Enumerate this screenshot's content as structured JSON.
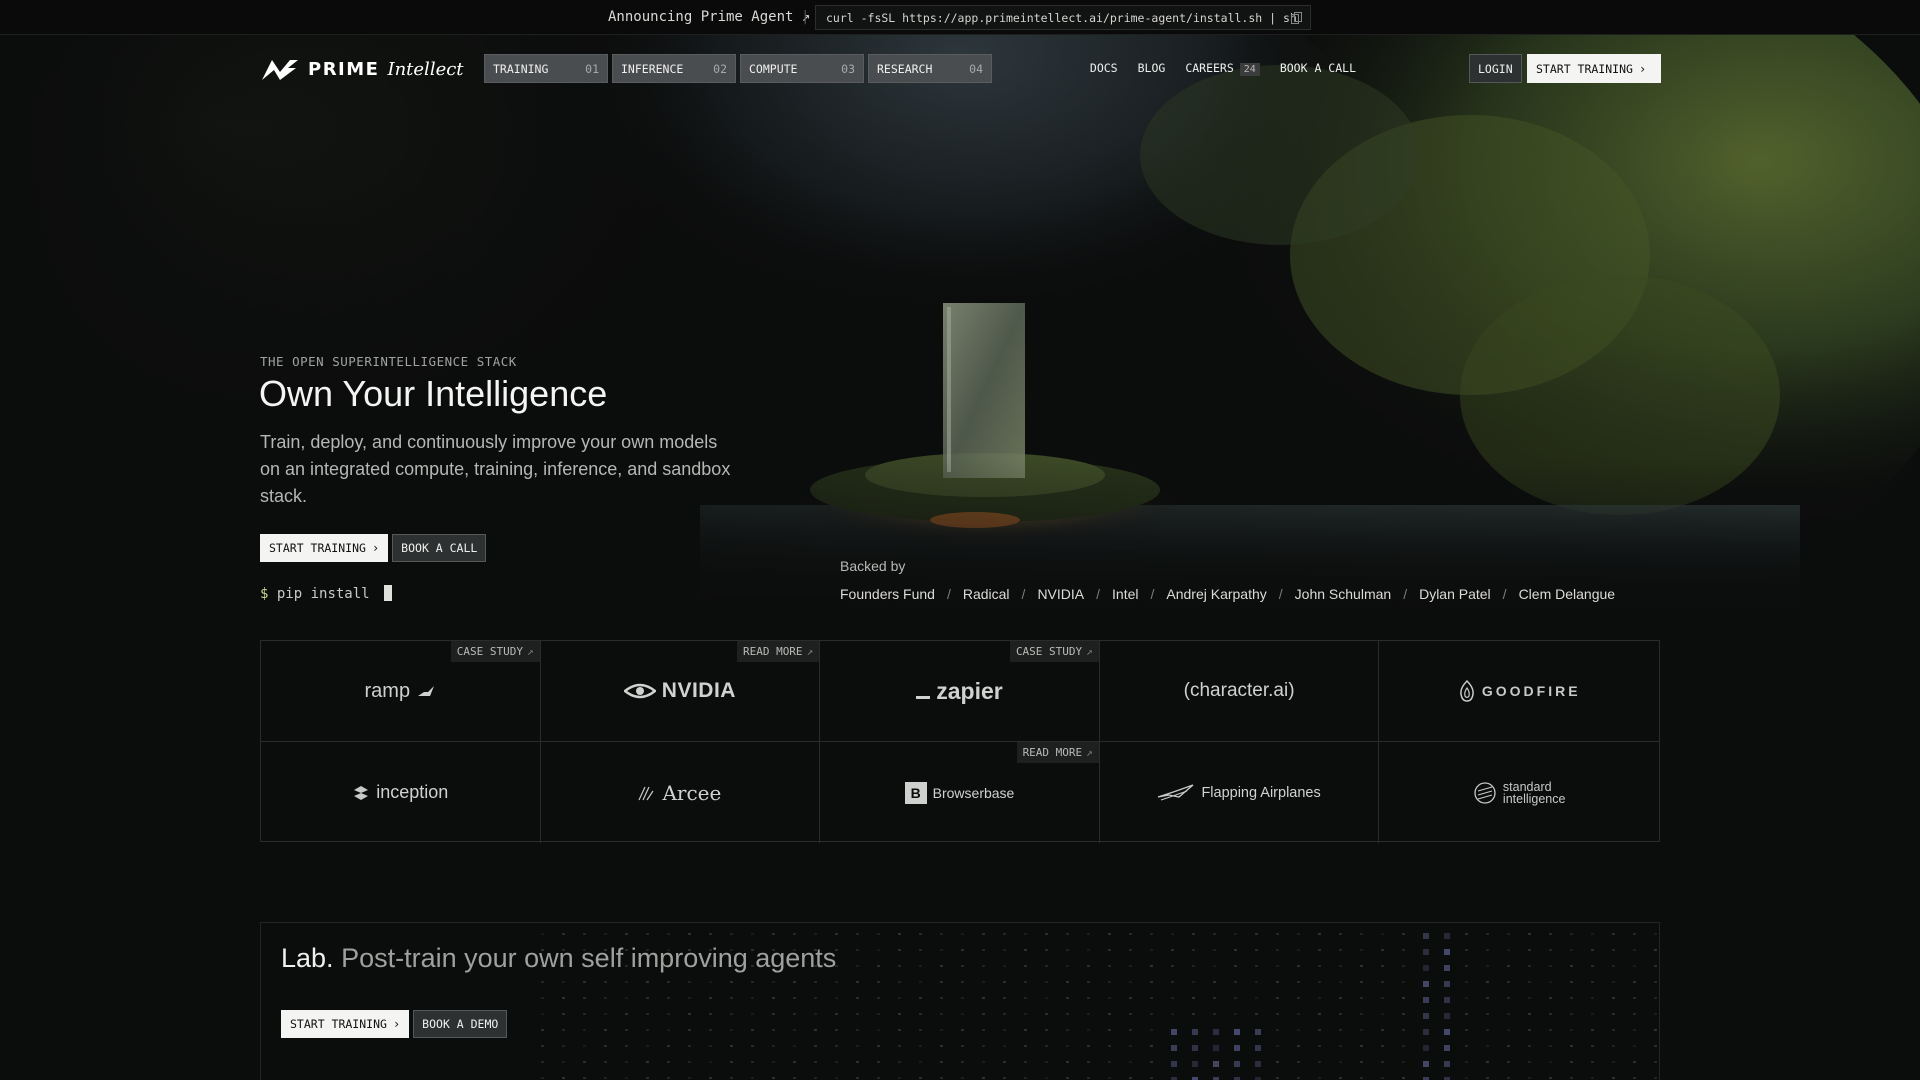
{
  "announcement": {
    "text": "Announcing Prime Agent ↗",
    "separator": "|",
    "command": "curl -fsSL https://app.primeintellect.ai/prime-agent/install.sh | sh",
    "copy_icon": "copy-icon"
  },
  "nav": {
    "logo_prime": "PRIME",
    "logo_intellect": "Intellect",
    "tabs": [
      {
        "label": "TRAINING",
        "num": "01"
      },
      {
        "label": "INFERENCE",
        "num": "02"
      },
      {
        "label": "COMPUTE",
        "num": "03"
      },
      {
        "label": "RESEARCH",
        "num": "04"
      }
    ],
    "links": {
      "docs": "DOCS",
      "blog": "BLOG",
      "careers": "CAREERS",
      "careers_count": "24",
      "book_call": "BOOK A CALL"
    },
    "login": "LOGIN",
    "start_training": "START TRAINING",
    "chevron": "›"
  },
  "hero": {
    "eyebrow": "THE OPEN SUPERINTELLIGENCE STACK",
    "title": "Own Your Intelligence",
    "subtitle": "Train, deploy, and continuously improve your own models on an integrated compute, training, inference, and sandbox stack.",
    "start_training": "START TRAINING",
    "book_call": "BOOK A CALL",
    "chevron": "›",
    "prompt_symbol": "$",
    "pip_command": "pip install",
    "backed_by_label": "Backed by",
    "backers": [
      "Founders Fund",
      "Radical",
      "NVIDIA",
      "Intel",
      "Andrej Karpathy",
      "John Schulman",
      "Dylan Patel",
      "Clem Delangue"
    ],
    "backer_separator": "/"
  },
  "logos": {
    "case_study": "CASE STUDY",
    "read_more": "READ MORE",
    "arrow": "↗",
    "ramp": "ramp",
    "nvidia": "NVIDIA",
    "zapier": "zapier",
    "characterai": "(character.ai)",
    "goodfire": "GOODFIRE",
    "inception": "inception",
    "arcee": "Arcee",
    "browserbase": "Browserbase",
    "browserbase_mark": "B",
    "flapping": "Flapping Airplanes",
    "standard_line1": "standard",
    "standard_line2": "intelligence"
  },
  "lab": {
    "title": "Lab.",
    "subtitle": "Post-train your own self improving agents",
    "start_training": "START TRAINING",
    "book_demo": "BOOK A DEMO",
    "chevron": "›"
  },
  "colors": {
    "background": "#0b0c0c",
    "tab_bg": "#4a4d4f",
    "accent_prompt": "#c7d68a",
    "button_light": "#f4f4f2"
  }
}
